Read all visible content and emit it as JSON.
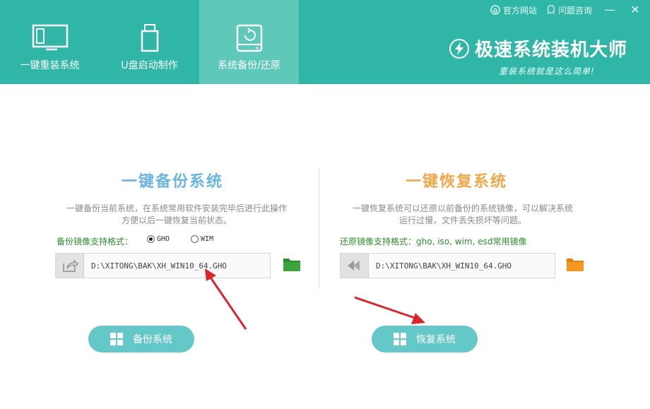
{
  "tabs": [
    {
      "label": "一键重装系统",
      "icon": "monitor-icon"
    },
    {
      "label": "U盘启动制作",
      "icon": "usb-drive-icon"
    },
    {
      "label": "系统备份/还原",
      "icon": "backup-drive-icon",
      "active": true
    }
  ],
  "topbar": {
    "website_label": "官方网站",
    "support_label": "问题咨询",
    "minimize": "—",
    "close": "✕"
  },
  "brand": {
    "title": "极速系统装机大师",
    "slogan": "重装系统就是这么简单!"
  },
  "backup": {
    "title": "一键备份系统",
    "description_line1": "一键备份当前系统，在系统常用软件安装完毕后进行此操作",
    "description_line2": "方便以后一键恢复当前状态。",
    "format_label": "备份镜像支持格式：",
    "options": [
      {
        "label": "GHO",
        "selected": true
      },
      {
        "label": "WIM",
        "selected": false
      }
    ],
    "path": "D:\\XITONG\\BAK\\XH_WIN10_64.GHO",
    "button_label": "备份系统"
  },
  "restore": {
    "title": "一键恢复系统",
    "description_line1": "一键恢复系统可以还原以前备份的系统镜像，可以解决系统",
    "description_line2": "运行过慢，文件丢失损坏等问题。",
    "format_label": "还原镜像支持格式：gho, iso, wim, esd常用镜像",
    "path": "D:\\XITONG\\BAK\\XH_WIN10_64.GHO",
    "button_label": "恢复系统"
  },
  "colors": {
    "header": "#2fb6a6",
    "active_tab": "#5ec8ba",
    "button": "#65c8c8",
    "backup_title": "#6ab5e2",
    "restore_title": "#f0a84a",
    "format_label": "#2b8f2b",
    "arrow": "#d9262a"
  }
}
